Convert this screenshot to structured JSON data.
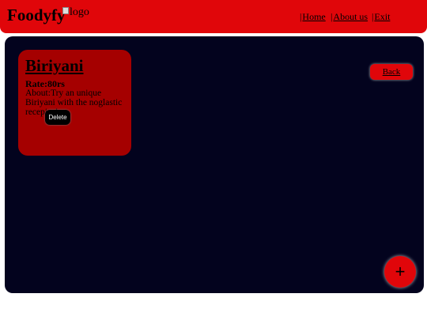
{
  "header": {
    "brand": "Foodyfy",
    "logo_alt": "logo",
    "nav": [
      {
        "label": "Home"
      },
      {
        "label": "About us"
      },
      {
        "label": "Exit"
      }
    ]
  },
  "card": {
    "title": "Biriyani",
    "rate": "Rate:80rs",
    "about": "About:Try an unique Biriyani with the noglastic recepies!",
    "delete_label": "Delete"
  },
  "back_label": "Back",
  "fab_label": "+",
  "colors": {
    "header_red": "#e0060a",
    "panel_navy": "#03031e",
    "card_red": "#a50000"
  }
}
